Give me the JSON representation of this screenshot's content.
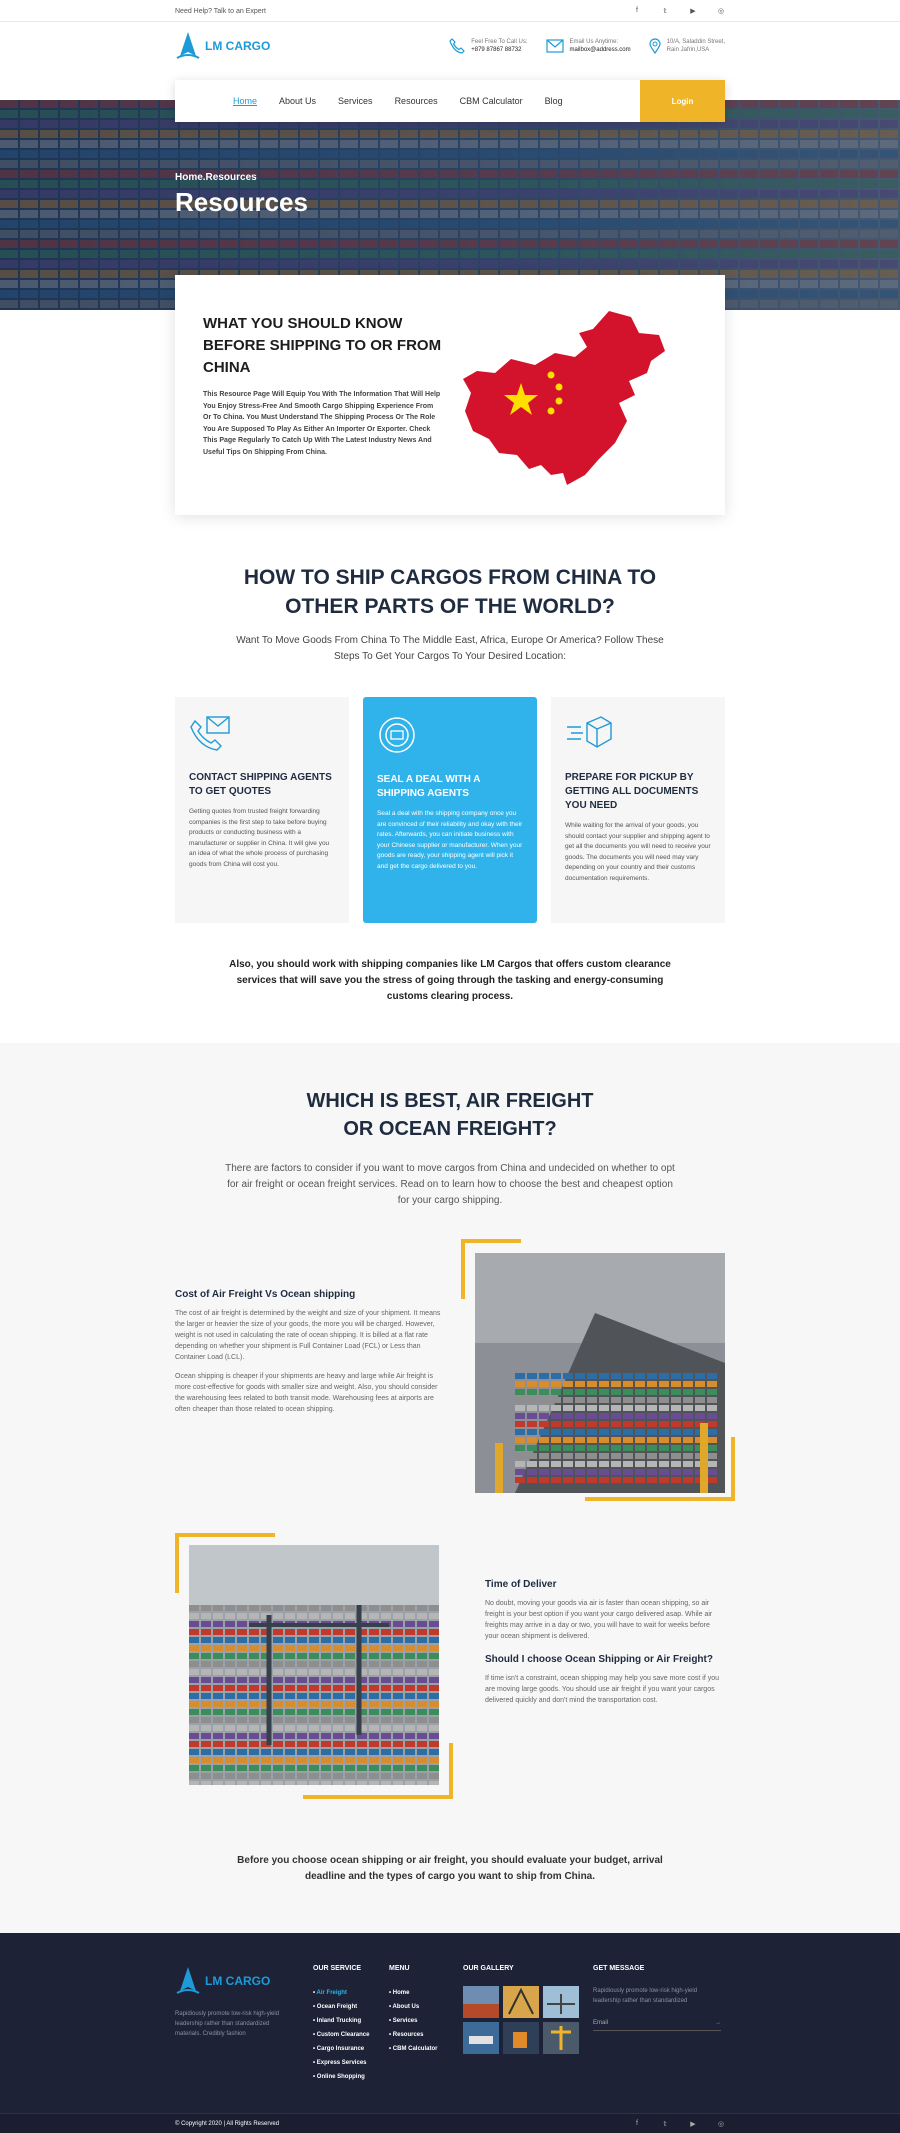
{
  "topbar": {
    "help": "Need Help? Talk to an Expert",
    "social": [
      "facebook-icon",
      "twitter-icon",
      "youtube-icon",
      "instagram-icon"
    ]
  },
  "brand": {
    "name": "LM CARGO",
    "color": "#1e9bd7",
    "accent": "#f0b429"
  },
  "contacts": [
    {
      "icon": "phone-icon",
      "label": "Feel Free To Call Us:",
      "value": "+879 87867 88732"
    },
    {
      "icon": "mail-icon",
      "label": "Email Us Anytime:",
      "value": "mailbox@address.com"
    },
    {
      "icon": "location-icon",
      "label": "10/A, Saladdin Street,",
      "value": "Rain Jafrin,USA"
    }
  ],
  "nav": {
    "items": [
      "Home",
      "About Us",
      "Services",
      "Resources",
      "CBM Calculator",
      "Blog"
    ],
    "active": "Home",
    "login": "Login"
  },
  "hero": {
    "crumb": "Home.Resources",
    "title": "Resources"
  },
  "intro": {
    "title": "WHAT YOU SHOULD KNOW BEFORE SHIPPING TO OR FROM CHINA",
    "body": "This Resource Page Will Equip You With The Information That Will Help You Enjoy Stress-Free And Smooth Cargo Shipping Experience From Or To China. You Must Understand The Shipping Process Or The Role You Are Supposed To Play As Either An Importer Or Exporter. Check This Page Regularly To Catch Up With The Latest Industry News And Useful Tips On Shipping From China."
  },
  "howto": {
    "title_line1": "HOW TO SHIP CARGOS FROM CHINA TO",
    "title_line2": "OTHER PARTS OF THE WORLD?",
    "sub": "Want To Move Goods From China To The Middle East, Africa, Europe Or America? Follow These Steps To Get Your Cargos To Your Desired Location:",
    "steps": [
      {
        "icon": "contact-phone-icon",
        "title": "CONTACT SHIPPING AGENTS TO GET QUOTES",
        "body": "Getting quotes from trusted freight forwarding companies is the first step to take before buying products or conducting business with a manufacturer or supplier in China. It will give you an idea of what the whole process of purchasing goods from China will cost you."
      },
      {
        "icon": "seal-icon",
        "title": "SEAL A DEAL WITH A SHIPPING AGENTS",
        "body": "Seal a deal with the shipping company once you are convinced of their reliability and okay with their rates. Afterwards, you can initiate business with your Chinese supplier or manufacturer. When your goods are ready, your shipping agent will pick it and get the cargo delivered to you."
      },
      {
        "icon": "delivery-box-icon",
        "title": "PREPARE FOR PICKUP BY GETTING ALL DOCUMENTS YOU NEED",
        "body": "While waiting for the arrival of your goods, you should contact your supplier and shipping agent to get all the documents you will need to receive your goods. The documents you will need may vary depending on your country and their customs documentation requirements."
      }
    ],
    "after": "Also, you should work with shipping companies like LM Cargos that offers custom clearance services that will save you the stress of going through the tasking and energy-consuming customs clearing process."
  },
  "freight": {
    "title_line1": "WHICH IS BEST, AIR FREIGHT",
    "title_line2": "OR OCEAN FREIGHT?",
    "sub": "There are factors to consider if you want to move cargos from China and undecided on whether to opt for air freight or ocean freight services. Read on to learn how to choose the best and cheapest option for your cargo shipping.",
    "cost_title": "Cost of Air Freight Vs Ocean shipping",
    "cost_p1": "The cost of air freight is determined by the weight and size of your shipment. It means the larger or heavier the size of your goods, the more you will be charged. However, weight is not used in calculating the rate of ocean shipping. It is billed at a flat rate depending on whether your shipment is Full Container Load (FCL) or Less than Container Load (LCL).",
    "cost_p2": "Ocean shipping is cheaper if your shipments are heavy and large while Air freight is more cost-effective for goods with smaller size and weight. Also, you should consider the warehousing fees related to both transit mode. Warehousing fees at airports are often cheaper than those related to ocean shipping.",
    "time_title": "Time of Deliver",
    "time_p": "No doubt, moving your goods via air is faster than ocean shipping, so air freight is your best option if you want your cargo delivered asap. While air freights may arrive in a day or two, you will have to wait for weeks before your ocean shipment is delivered.",
    "choose_title": "Should I choose Ocean Shipping or Air Freight?",
    "choose_p": "If time isn't a constraint, ocean shipping may help you save more cost if you are moving large goods. You should use air freight if you want your cargos delivered quickly and don't mind the transportation cost.",
    "final": "Before you choose ocean shipping or air freight, you should evaluate your budget, arrival deadline and the types of cargo you want to ship from China."
  },
  "footer": {
    "desc": "Rapidiously promote low-risk high-yield leadership rather than standardized materials. Credibly fashion",
    "service_title": "OUR SERVICE",
    "services": [
      "Air Freight",
      "Ocean Freight",
      "Inland Trucking",
      "Custom Clearance",
      "Cargo Insurance",
      "Express Services",
      "Online Shopping"
    ],
    "menu_title": "MENU",
    "menu": [
      "Home",
      "About Us",
      "Services",
      "Resources",
      "CBM Calculator"
    ],
    "gallery_title": "OUR GALLERY",
    "message_title": "GET MESSAGE",
    "message_desc": "Rapidiously promote low-risk high-yield leadership rather than standardized",
    "email_placeholder": "Email",
    "copyright": "© Copyright 2020 | All Rights Reserved"
  }
}
